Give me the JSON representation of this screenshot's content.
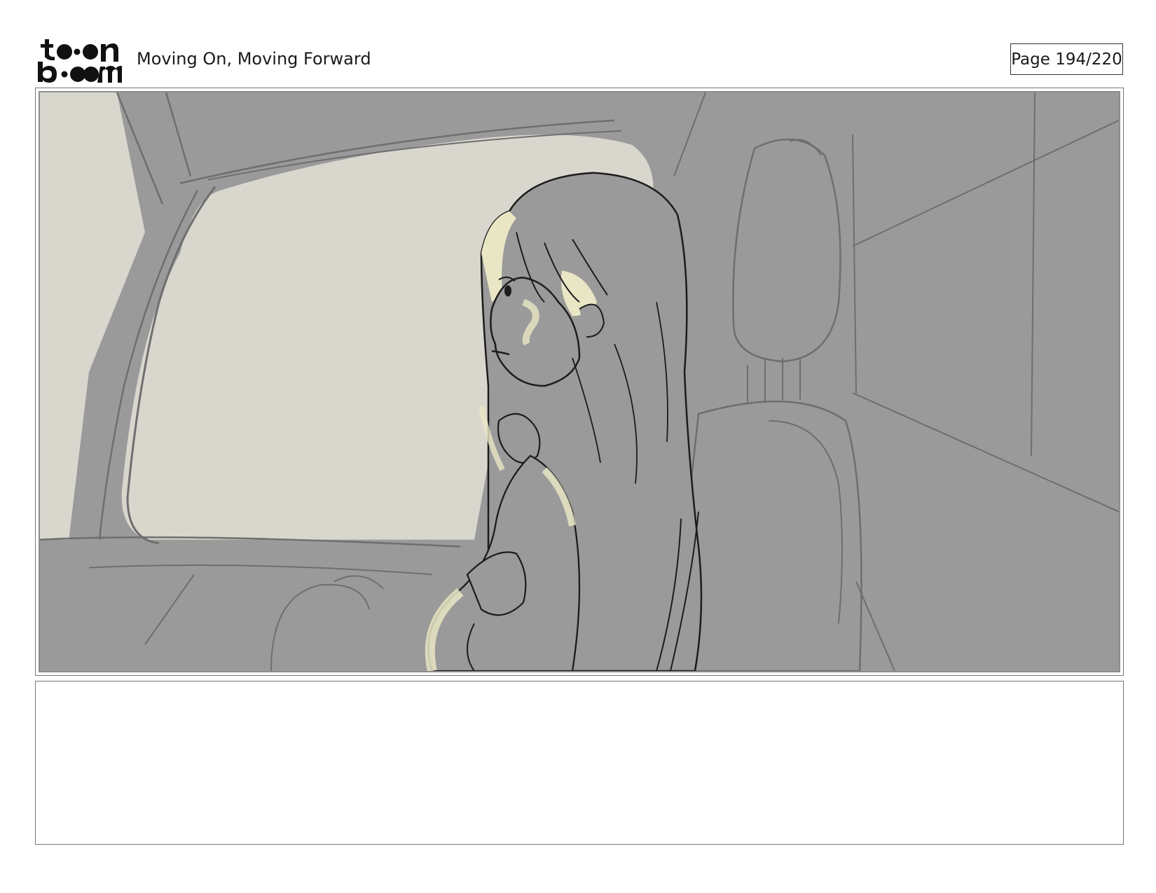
{
  "header": {
    "logo_text": "toon boom",
    "project_title": "Moving On, Moving Forward",
    "page_indicator": "Page 194/220"
  },
  "panel": {
    "scene_colors": {
      "background_gray": "#9a9a9a",
      "window_light": "#d9d6ce",
      "rim_light": "#e8e6c4",
      "line_dark": "#1c1c1c",
      "line_light": "#6e6e6e"
    }
  },
  "notes": {
    "text": ""
  }
}
